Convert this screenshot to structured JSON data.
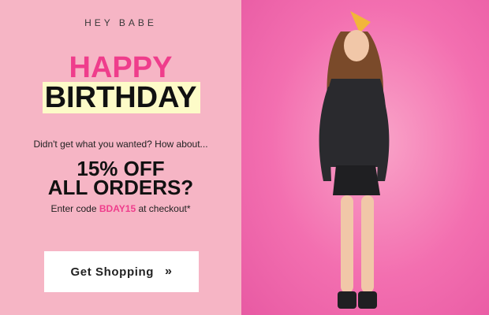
{
  "brand": "HEY BABE",
  "headline": {
    "line1": "HAPPY",
    "line2": "BIRTHDAY"
  },
  "teaser": "Didn't get what you wanted? How about...",
  "offer": {
    "line1": "15% OFF",
    "line2": "ALL ORDERS?"
  },
  "code_line": {
    "prefix": "Enter code",
    "code": "BDAY15",
    "suffix": "at checkout*"
  },
  "cta": {
    "label": "Get Shopping",
    "arrow": "»"
  },
  "colors": {
    "panel_bg": "#f6b5c5",
    "accent_pink": "#ef3d8c",
    "highlight_yellow": "#fdfbc8",
    "photo_bg": "#f36fb0"
  }
}
